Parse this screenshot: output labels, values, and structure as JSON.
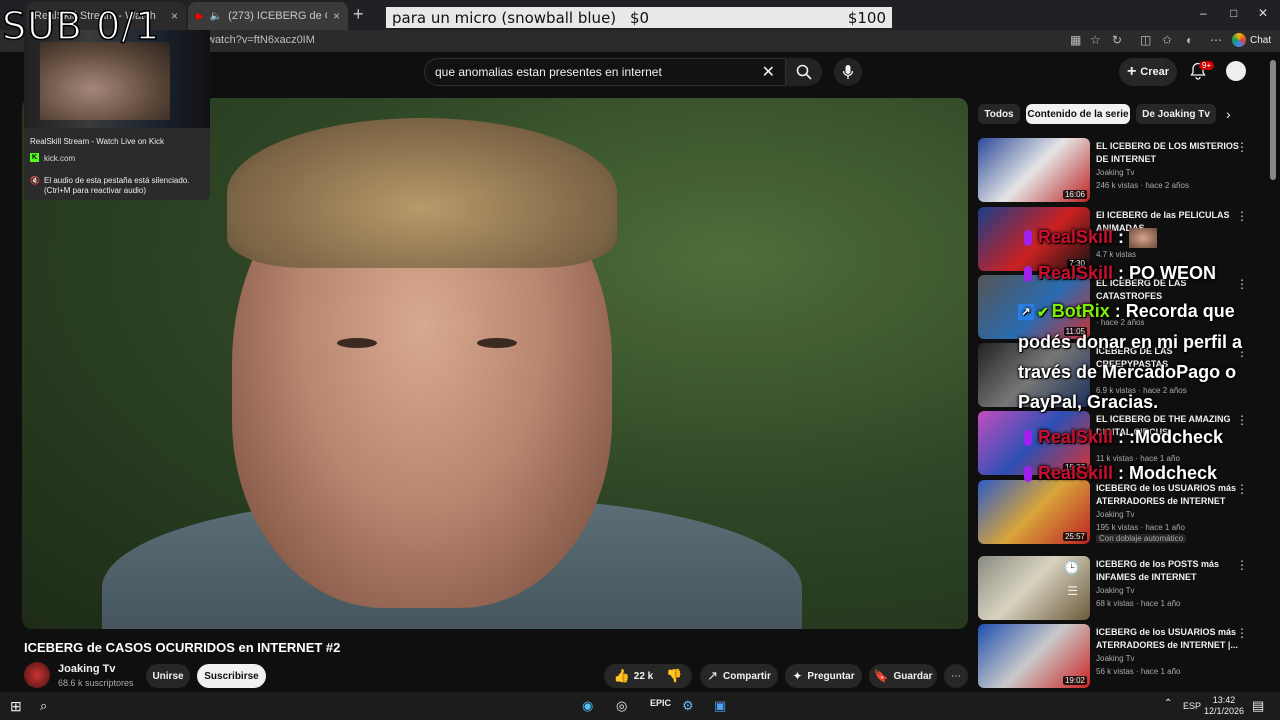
{
  "browser": {
    "tabs": [
      {
        "label": "RealSkill Stream - Watch Live on Kick",
        "close": "×"
      },
      {
        "label": "(273) ICEBERG de CASOS OCURRIDOS",
        "close": "×"
      }
    ],
    "new_tab": "+",
    "url": "watch?v=ftN6xacz0IM",
    "chat_button": "Chat",
    "window_controls": {
      "minimize": "–",
      "maximize": "□",
      "close": "✕"
    }
  },
  "tab_preview": {
    "title": "RealSkill Stream - Watch Live on Kick",
    "domain": "kick.com",
    "mute_notice": "El audio de esta pestaña está silenciado. (Ctrl+M para reactivar audio)"
  },
  "overlay": {
    "sub_counter": "SUB 0/1",
    "goal": {
      "label": "para un micro (snowball blue)",
      "current": "$0",
      "target": "$100",
      "progress": 0
    }
  },
  "youtube": {
    "search": {
      "query": "que anomalias estan presentes en internet"
    },
    "create_label": "Crear",
    "notif_count": "9+",
    "video": {
      "title": "ICEBERG de CASOS OCURRIDOS en INTERNET #2",
      "channel": "Joaking Tv",
      "subscribers": "68.6 k suscriptores",
      "join": "Unirse",
      "subscribe": "Suscribirse",
      "likes": "22 k",
      "share": "Compartir",
      "ask": "Preguntar",
      "save": "Guardar"
    },
    "chips": [
      "Todos",
      "Contenido de la serie",
      "De Joaking Tv"
    ],
    "recommendations": [
      {
        "title": "EL ICEBERG DE LOS MISTERIOS DE INTERNET",
        "channel": "Joaking Tv",
        "meta": "246 k vistas · hace 2 años",
        "duration": "16:06"
      },
      {
        "title": "El ICEBERG de las PELICULAS ANIMADAS",
        "channel": "",
        "meta": "4.7 k vistas",
        "duration": "7:30"
      },
      {
        "title": "EL ICEBERG DE LAS CATASTROFES",
        "channel": "",
        "meta": "· hace 2 años",
        "duration": "11:05"
      },
      {
        "title": "ICEBERG DE LAS CREEPYPASTAS",
        "channel": "",
        "meta": "6.9 k vistas · hace 2 años",
        "duration": ""
      },
      {
        "title": "EL ICEBERG DE THE AMAZING DIGITAL CIRCUS",
        "channel": "",
        "meta": "11 k vistas · hace 1 año",
        "duration": "15:37"
      },
      {
        "title": "ICEBERG de los USUARIOS más ATERRADORES de INTERNET",
        "channel": "Joaking Tv",
        "meta": "195 k vistas · hace 1 año",
        "duration": "25:57",
        "badge": "Con doblaje automático"
      },
      {
        "title": "ICEBERG de los POSTS más INFAMES de INTERNET",
        "channel": "Joaking Tv",
        "meta": "68 k vistas · hace 1 año",
        "duration": ""
      },
      {
        "title": "ICEBERG de los USUARIOS más ATERRADORES de INTERNET |...",
        "channel": "Joaking Tv",
        "meta": "56 k vistas · hace 1 año",
        "duration": "19:02"
      }
    ]
  },
  "chat": [
    {
      "user": "RealSkill",
      "text": " : "
    },
    {
      "user": "RealSkill",
      "text": " : PO WEON"
    },
    {
      "user": "BotRix",
      "text": " : Recorda que podés donar en mi perfil a través de MercadoPago o PayPal, Gracias."
    },
    {
      "user": "RealSkill",
      "text": " : :Modcheck"
    },
    {
      "user": "RealSkill",
      "text": " : Modcheck"
    }
  ],
  "taskbar": {
    "lang": "ESP",
    "time": "13:42",
    "date": "12/1/2026"
  },
  "colors": {
    "youtube_bg": "#0f0f0f",
    "chat_user": "#c8102e",
    "bot_user": "#7cf000",
    "kick_green": "#53fc18"
  }
}
